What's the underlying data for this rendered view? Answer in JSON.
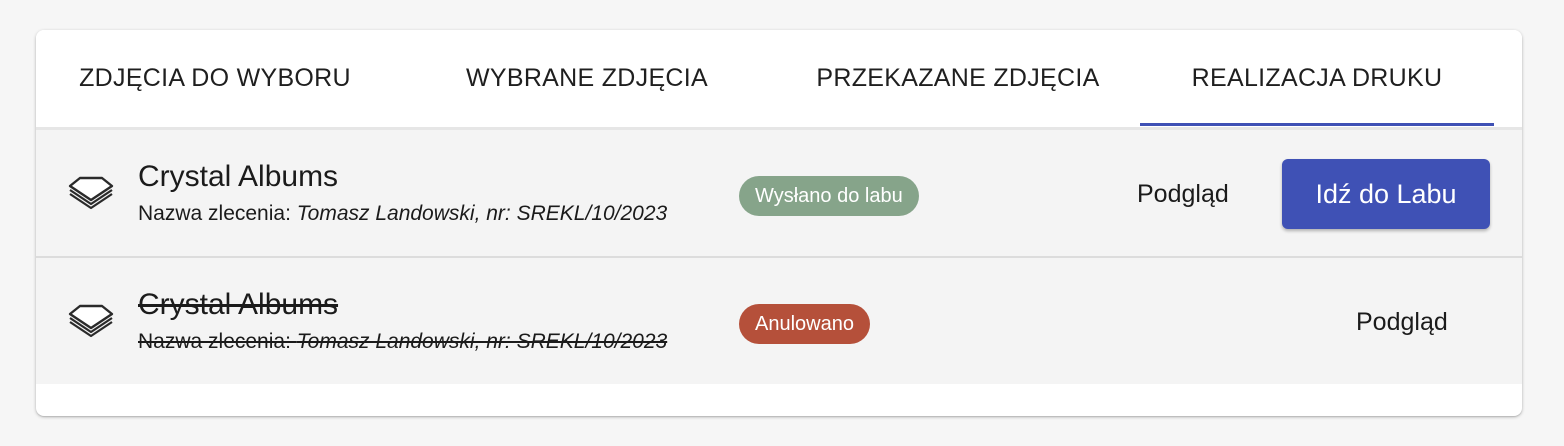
{
  "tabs": [
    {
      "label": "ZDJĘCIA DO WYBORU"
    },
    {
      "label": "WYBRANE ZDJĘCIA"
    },
    {
      "label": "PRZEKAZANE ZDJĘCIA"
    },
    {
      "label": "REALIZACJA DRUKU"
    }
  ],
  "active_tab": "REALIZACJA DRUKU",
  "orders": [
    {
      "icon": "layers-icon",
      "title": "Crystal Albums",
      "order_prefix": "Nazwa zlecenia: ",
      "order_value": "Tomasz Landowski, nr: SREKL/10/2023",
      "status": "Wysłano do labu",
      "status_color": "#86a48a",
      "preview_label": "Podgląd",
      "action_label": "Idź do Labu",
      "cancelled": false
    },
    {
      "icon": "layers-icon",
      "title": "Crystal Albums",
      "order_prefix": "Nazwa zlecenia: ",
      "order_value": "Tomasz Landowski, nr: SREKL/10/2023",
      "status": "Anulowano",
      "status_color": "#b5503a",
      "preview_label": "Podgląd",
      "cancelled": true
    }
  ],
  "colors": {
    "accent": "#3f51b5",
    "row_background": "#f4f4f4"
  }
}
